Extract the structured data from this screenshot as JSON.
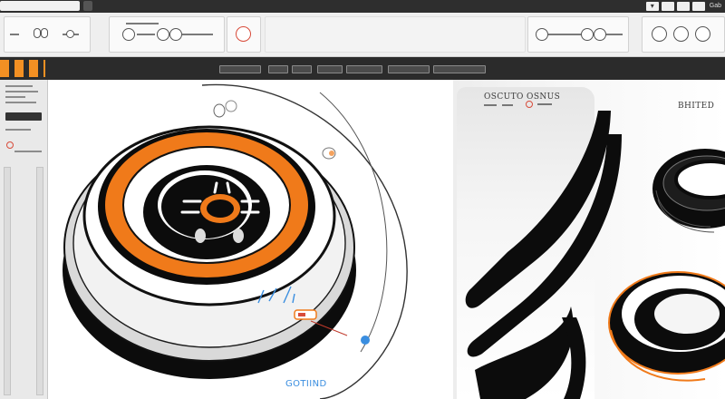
{
  "window": {
    "corner_label": "Gab"
  },
  "canvas": {
    "caption": "GOTIIND"
  },
  "right_panel": {
    "card_title": "OSCUTO OSNUS",
    "header_caption": "BHITED"
  },
  "colors": {
    "accent_orange": "#f07a1a",
    "accent_red": "#d84b3a",
    "accent_blue": "#3a8ee0",
    "chrome_dark": "#2b2b2b",
    "tire_black": "#0c0c0c"
  },
  "icons": {
    "window_close": "close-icon",
    "window_min": "minimize-icon",
    "window_menu": "menu-icon"
  }
}
